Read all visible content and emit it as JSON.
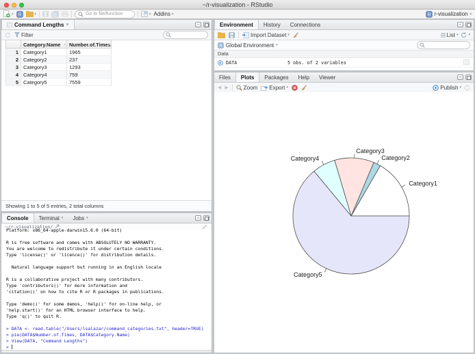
{
  "window": {
    "title": "~/r-visualization - RStudio",
    "project_label": "r-visualization"
  },
  "main_toolbar": {
    "goto_placeholder": "Go to file/function",
    "addins_label": "Addins"
  },
  "icons": {
    "chevron_down": "▾",
    "close": "×",
    "minimize": "–",
    "back": "◀",
    "forward": "▶",
    "sort_up": "▴"
  },
  "data_viewer": {
    "tab_label": "Command Lengths",
    "filter_label": "Filter",
    "columns": [
      "Category.Name",
      "Number.of.Times"
    ],
    "rows": [
      {
        "num": "1",
        "name": "Category1",
        "times": "1965"
      },
      {
        "num": "2",
        "name": "Category2",
        "times": "237"
      },
      {
        "num": "3",
        "name": "Category3",
        "times": "1293"
      },
      {
        "num": "4",
        "name": "Category4",
        "times": "759"
      },
      {
        "num": "5",
        "name": "Category5",
        "times": "7559"
      }
    ],
    "status": "Showing 1 to 5 of 5 entries, 2 total columns"
  },
  "console": {
    "tabs": [
      "Console",
      "Terminal",
      "Jobs"
    ],
    "working_dir": "~/r-visualization/",
    "lines": [
      {
        "type": "output",
        "text": "Platform: x86_64-apple-darwin15.6.0 (64-bit)"
      },
      {
        "type": "output",
        "text": ""
      },
      {
        "type": "output",
        "text": "R is free software and comes with ABSOLUTELY NO WARRANTY."
      },
      {
        "type": "output",
        "text": "You are welcome to redistribute it under certain conditions."
      },
      {
        "type": "output",
        "text": "Type 'license()' or 'licence()' for distribution details."
      },
      {
        "type": "output",
        "text": ""
      },
      {
        "type": "output",
        "text": "  Natural language support but running in an English locale"
      },
      {
        "type": "output",
        "text": ""
      },
      {
        "type": "output",
        "text": "R is a collaborative project with many contributors."
      },
      {
        "type": "output",
        "text": "Type 'contributors()' for more information and"
      },
      {
        "type": "output",
        "text": "'citation()' on how to cite R or R packages in publications."
      },
      {
        "type": "output",
        "text": ""
      },
      {
        "type": "output",
        "text": "Type 'demo()' for some demos, 'help()' for on-line help, or"
      },
      {
        "type": "output",
        "text": "'help.start()' for an HTML browser interface to help."
      },
      {
        "type": "output",
        "text": "Type 'q()' to quit R."
      },
      {
        "type": "output",
        "text": ""
      },
      {
        "type": "input",
        "text": "> DATA <- read.table(\"/Users/lsalazar/command_categories.txt\", header=TRUE)"
      },
      {
        "type": "input",
        "text": "> pie(DATA$Number.of.Times, DATA$Category.Name)"
      },
      {
        "type": "input",
        "text": "> View(DATA, \"Command Lengths\")"
      },
      {
        "type": "input",
        "text": "> "
      }
    ]
  },
  "environment": {
    "tabs": [
      "Environment",
      "History",
      "Connections"
    ],
    "import_dataset_label": "Import Dataset",
    "list_label": "List",
    "scope_label": "Global Environment",
    "section_label": "Data",
    "objects": [
      {
        "name": "DATA",
        "summary": "5 obs. of 2 variables"
      }
    ]
  },
  "plots_pane": {
    "tabs": [
      "Files",
      "Plots",
      "Packages",
      "Help",
      "Viewer"
    ],
    "active_tab": "Plots",
    "zoom_label": "Zoom",
    "export_label": "Export",
    "publish_label": "Publish"
  },
  "chart_data": {
    "type": "pie",
    "title": "",
    "categories": [
      "Category1",
      "Category2",
      "Category3",
      "Category4",
      "Category5"
    ],
    "values": [
      1965,
      237,
      1293,
      759,
      7559
    ],
    "colors": [
      "#FFFFFF",
      "#ADD8E6",
      "#FFE4E1",
      "#E0FFFF",
      "#E6E6FA"
    ],
    "start_angle_deg": 0,
    "direction": "counterclockwise",
    "border_color": "#4d4d4d",
    "label_color": "#1a1a1a",
    "legend": "none"
  },
  "colors": {
    "console_input_blue": "#2424cc",
    "publish_blue": "#3f8fd4",
    "folder_yellow": "#e8b64c",
    "traffic_red": "#fc5753",
    "traffic_yellow": "#fdbc40",
    "traffic_green": "#33c748"
  }
}
